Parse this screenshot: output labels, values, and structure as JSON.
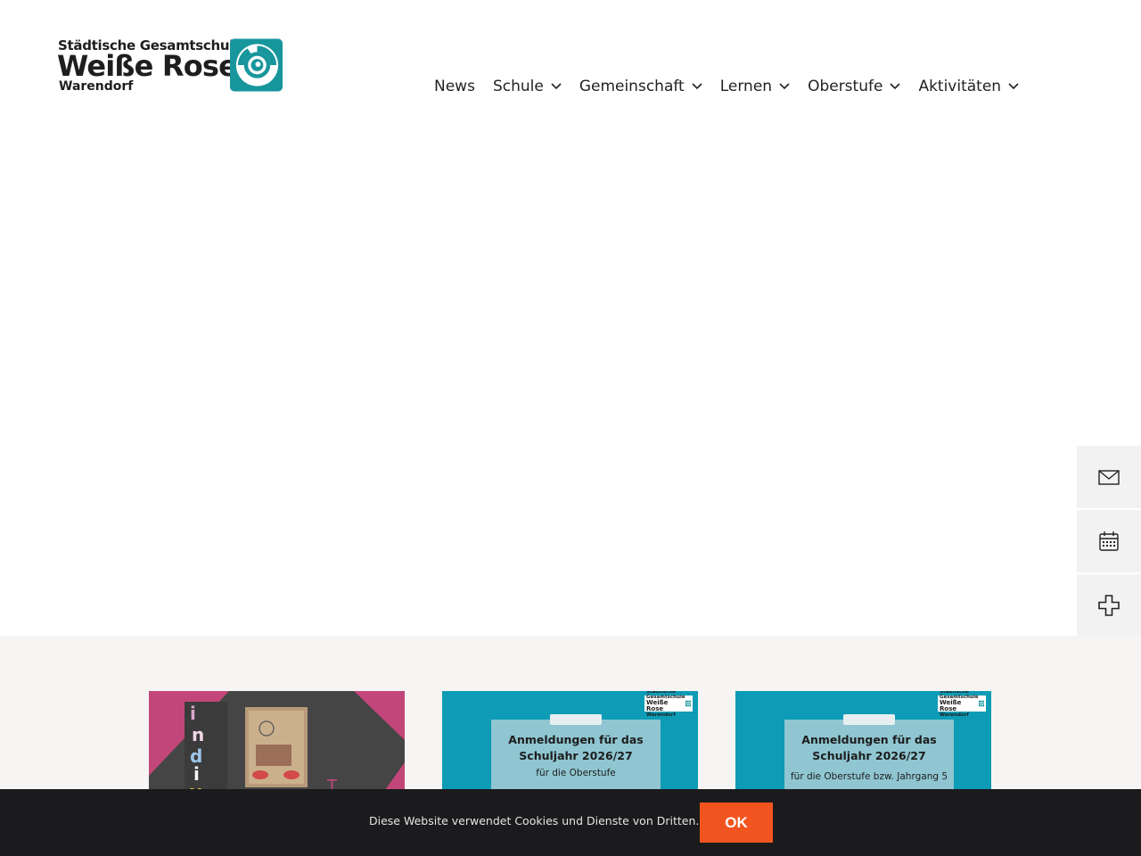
{
  "logo": {
    "line1": "Städtische Gesamtschule",
    "line2": "Weiße Rose",
    "line3": "Warendorf",
    "icon": "swirl-logo-icon",
    "accent_color": "#17969c"
  },
  "nav": {
    "items": [
      {
        "label": "News",
        "has_dropdown": false
      },
      {
        "label": "Schule",
        "has_dropdown": true
      },
      {
        "label": "Gemeinschaft",
        "has_dropdown": true
      },
      {
        "label": "Lernen",
        "has_dropdown": true
      },
      {
        "label": "Oberstufe",
        "has_dropdown": true
      },
      {
        "label": "Aktivitäten",
        "has_dropdown": true
      }
    ]
  },
  "quickbar": {
    "items": [
      {
        "icon": "mail-icon"
      },
      {
        "icon": "calendar-icon"
      },
      {
        "icon": "first-aid-cross-icon"
      },
      {
        "icon": "download-icon"
      }
    ]
  },
  "cards": [
    {
      "type": "image",
      "description_colors": [
        "#c2467a",
        "#4a4a4a"
      ]
    },
    {
      "type": "announcement",
      "title": "Anmeldungen für das Schuljahr 2026/27",
      "subtitle": "für die Oberstufe",
      "mini_logo_line1": "Städtische Gesamtschule",
      "mini_logo_line2": "Weiße Rose",
      "mini_logo_line3": "Warendorf"
    },
    {
      "type": "announcement",
      "title": "Anmeldungen für das Schuljahr 2026/27",
      "subtitle": "für die Oberstufe bzw. Jahrgang 5",
      "mini_logo_line1": "Städtische Gesamtschule",
      "mini_logo_line2": "Weiße Rose",
      "mini_logo_line3": "Warendorf"
    }
  ],
  "cookie": {
    "text": "Diese Website verwendet Cookies und Dienste von Dritten.",
    "button_label": "OK",
    "button_color": "#f2541f"
  }
}
